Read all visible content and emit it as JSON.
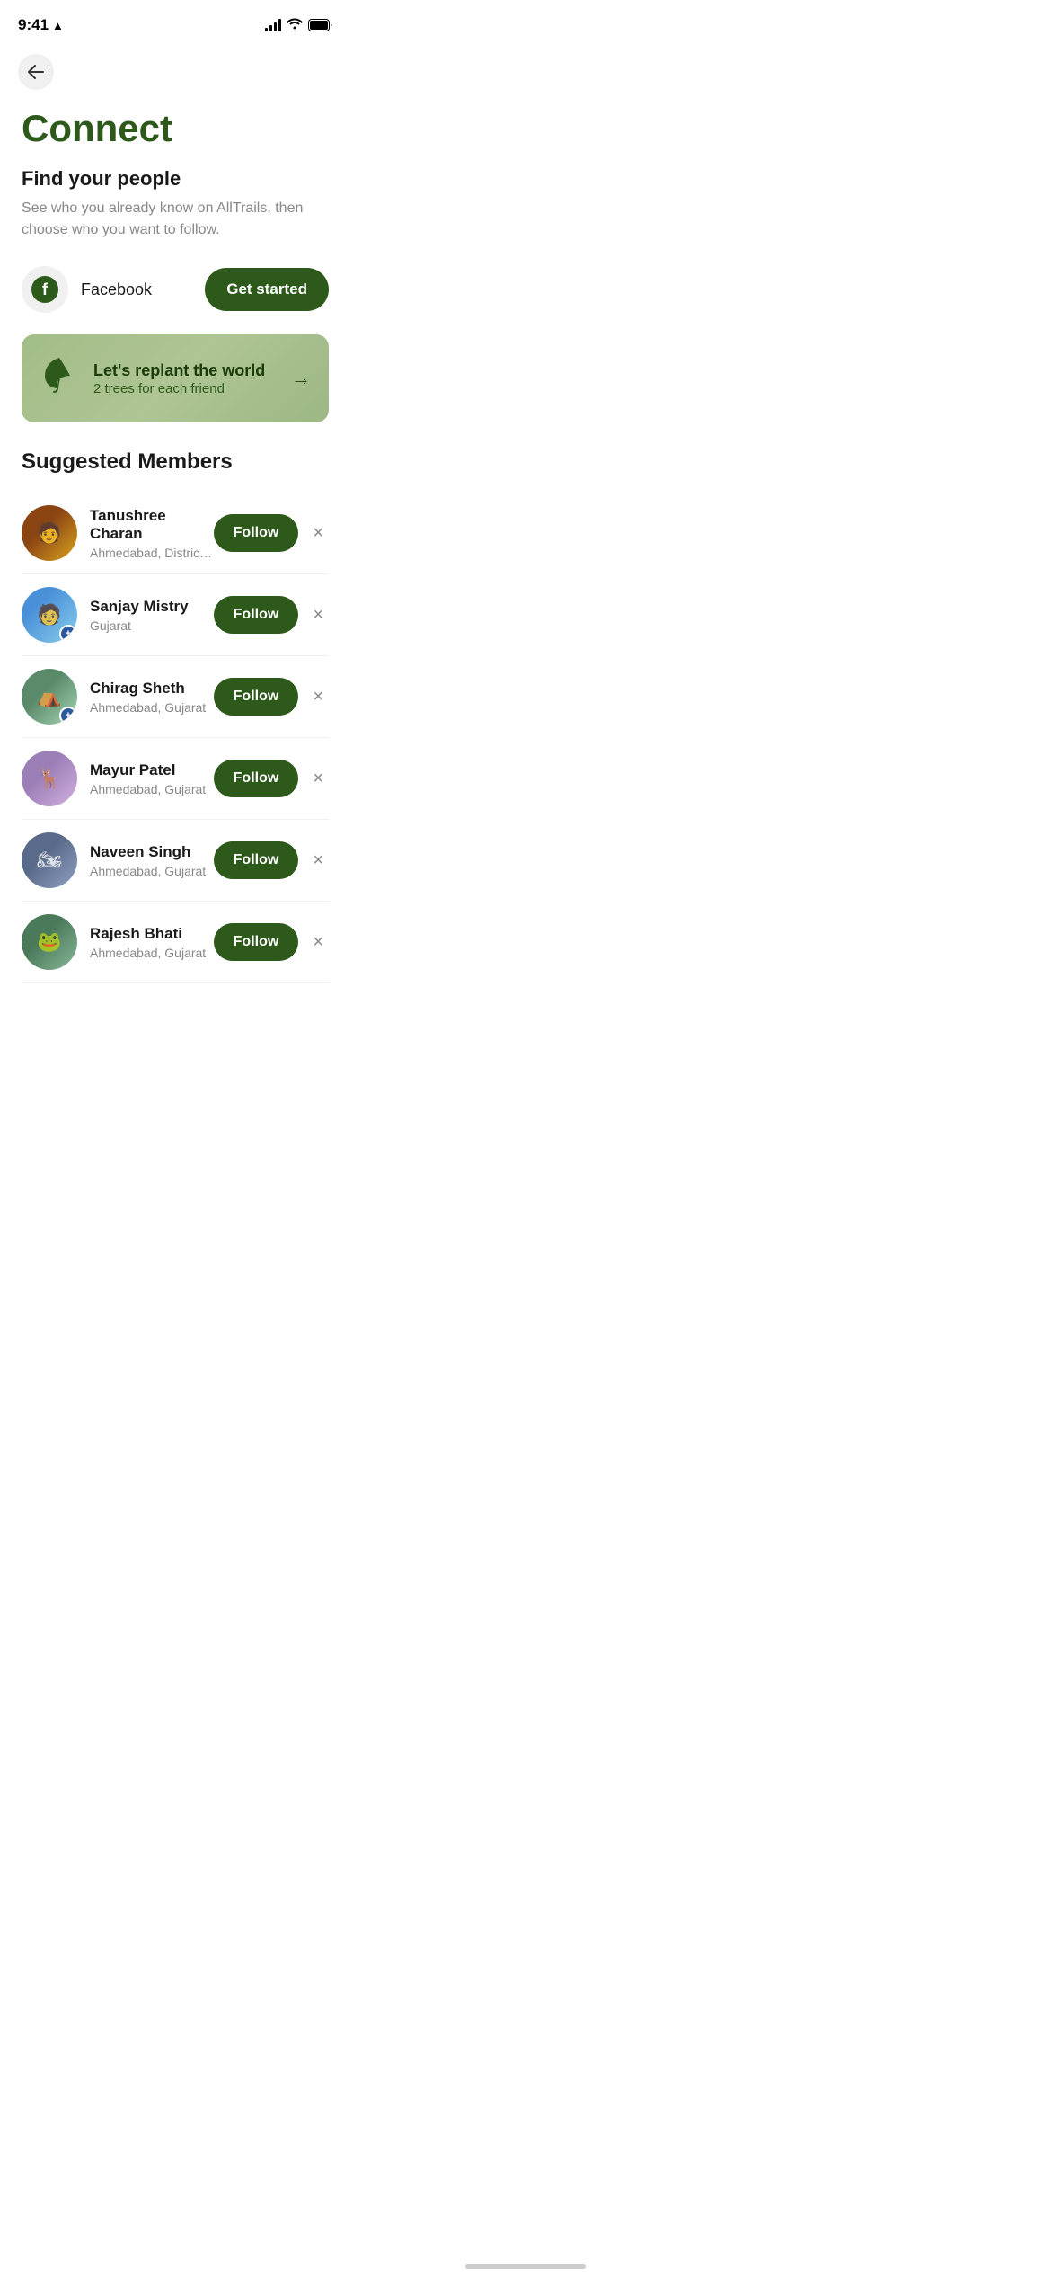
{
  "statusBar": {
    "time": "9:41",
    "hasLocation": true
  },
  "nav": {
    "backLabel": "←"
  },
  "header": {
    "title": "Connect",
    "subtitle": "Find your people",
    "description": "See who you already know on AllTrails, then choose who you want to follow."
  },
  "facebook": {
    "label": "Facebook",
    "buttonLabel": "Get started"
  },
  "banner": {
    "title": "Let's replant the world",
    "subtitle": "2 trees for each friend",
    "arrow": "→"
  },
  "suggestedSection": {
    "title": "Suggested Members"
  },
  "members": [
    {
      "id": 1,
      "name": "Tanushree Charan",
      "location": "Ahmedabad, District of Colu…",
      "hasBadge": false,
      "avatarClass": "av-1",
      "avatarEmoji": "🧑"
    },
    {
      "id": 2,
      "name": "Sanjay Mistry",
      "location": "Gujarat",
      "hasBadge": true,
      "avatarClass": "av-2",
      "avatarEmoji": "🧑"
    },
    {
      "id": 3,
      "name": "Chirag Sheth",
      "location": "Ahmedabad, Gujarat",
      "hasBadge": true,
      "avatarClass": "av-3",
      "avatarEmoji": "⛺"
    },
    {
      "id": 4,
      "name": "Mayur Patel",
      "location": "Ahmedabad, Gujarat",
      "hasBadge": false,
      "avatarClass": "av-4",
      "avatarEmoji": "🦌"
    },
    {
      "id": 5,
      "name": "Naveen Singh",
      "location": "Ahmedabad, Gujarat",
      "hasBadge": false,
      "avatarClass": "av-5",
      "avatarEmoji": "🏍"
    },
    {
      "id": 6,
      "name": "Rajesh Bhati",
      "location": "Ahmedabad, Gujarat",
      "hasBadge": false,
      "avatarClass": "av-6",
      "avatarEmoji": "🐸"
    }
  ],
  "followLabel": "Follow",
  "dismissLabel": "×"
}
